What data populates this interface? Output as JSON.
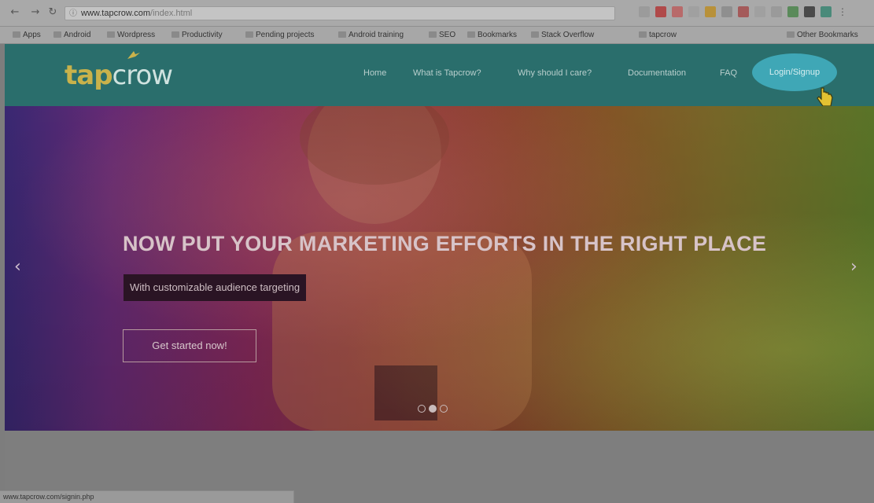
{
  "browser": {
    "url_host": "www.tapcrow.com",
    "url_path": "/index.html",
    "bookmarks": [
      "Apps",
      "Android",
      "Wordpress",
      "Productivity",
      "Pending projects",
      "Android training",
      "SEO",
      "Bookmarks",
      "Stack Overflow",
      "tapcrow",
      "Other Bookmarks"
    ],
    "status_text": "www.tapcrow.com/signin.php"
  },
  "site": {
    "logo_tap": "tap",
    "logo_crow": "crow",
    "nav": [
      "Home",
      "What is Tapcrow?",
      "Why should I care?",
      "Documentation",
      "FAQ"
    ],
    "login_label": "Login/Signup"
  },
  "hero": {
    "headline": "NOW PUT YOUR MARKETING EFFORTS IN THE RIGHT PLACE",
    "subline": "With customizable audience targeting",
    "cta": "Get started now!",
    "slides": 3,
    "active_slide": 1
  },
  "colors": {
    "header_bg": "#2a6e6c",
    "logo_accent": "#c9b24b",
    "login_bg": "#3fa7b6"
  }
}
